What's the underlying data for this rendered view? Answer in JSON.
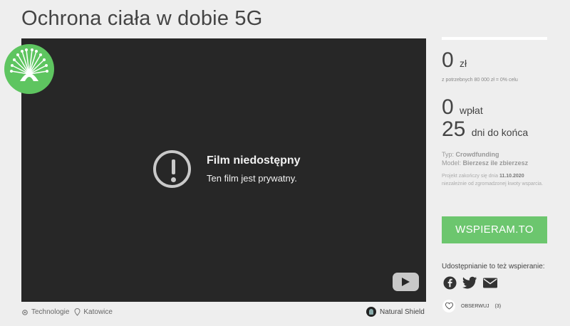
{
  "project": {
    "title": "Ochrona ciała w dobie 5G",
    "category": "Technologie",
    "location": "Katowice",
    "author": "Natural Shield"
  },
  "video": {
    "error_title": "Film niedostępny",
    "error_subtitle": "Ten film jest prywatny."
  },
  "funding": {
    "amount": "0",
    "currency": "zł",
    "goal_note": "z potrzebnych 80 000 zł = 0% celu",
    "backers": "0",
    "backers_label": "wpłat",
    "days": "25",
    "days_label": "dni do końca",
    "type_label": "Typ:",
    "type_value": "Crowdfunding",
    "model_label": "Model:",
    "model_value": "Bierzesz ile zbierzesz",
    "end_prefix": "Projekt zakończy się dnia",
    "end_date": "11.10.2020",
    "end_suffix": "niezależnie od zgromadzonej kwoty wsparcia."
  },
  "actions": {
    "support_button": "WSPIERAM.TO",
    "share_label": "Udostępnianie to też wspieranie:",
    "follow_label": "OBSERWUJ",
    "follow_count": "(3)"
  },
  "colors": {
    "accent": "#6cc66e",
    "video_bg": "#272727",
    "page_bg": "#eeeeee"
  },
  "icons": [
    "facebook-icon",
    "twitter-icon",
    "mail-icon",
    "heart-icon",
    "gear-icon",
    "location-pin-icon",
    "youtube-icon",
    "alert-icon"
  ]
}
